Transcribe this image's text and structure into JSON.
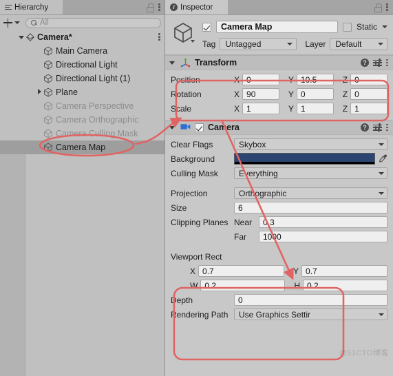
{
  "hierarchy": {
    "tab_label": "Hierarchy",
    "tab_icon": "hamburger-icon",
    "lock_icon": "lock-icon",
    "menu_icon": "kebab-menu-icon",
    "toolbar": {
      "add_icon": "plus-icon",
      "add_caret_icon": "chevron-down-icon",
      "search_icon": "search-icon",
      "search_placeholder": "All",
      "search_value": ""
    },
    "items": [
      {
        "label": "Camera*",
        "type": "scene",
        "indent": 0,
        "foldout": "open",
        "icon": "scene-icon",
        "dim": false,
        "selected": false,
        "menu_icon": "kebab-menu-icon"
      },
      {
        "label": "Main Camera",
        "type": "gameobject",
        "indent": 1,
        "foldout": "none",
        "icon": "gameobject-icon",
        "dim": false,
        "selected": false
      },
      {
        "label": "Directional Light",
        "type": "gameobject",
        "indent": 1,
        "foldout": "none",
        "icon": "gameobject-icon",
        "dim": false,
        "selected": false
      },
      {
        "label": "Directional Light (1)",
        "type": "gameobject",
        "indent": 1,
        "foldout": "none",
        "icon": "gameobject-icon",
        "dim": false,
        "selected": false
      },
      {
        "label": "Plane",
        "type": "gameobject",
        "indent": 1,
        "foldout": "closed",
        "icon": "gameobject-icon",
        "dim": false,
        "selected": false
      },
      {
        "label": "Camera Perspective",
        "type": "gameobject",
        "indent": 1,
        "foldout": "none",
        "icon": "gameobject-icon",
        "dim": true,
        "selected": false
      },
      {
        "label": "Camera Orthographic",
        "type": "gameobject",
        "indent": 1,
        "foldout": "none",
        "icon": "gameobject-icon",
        "dim": true,
        "selected": false
      },
      {
        "label": "Camera Culling Mask",
        "type": "gameobject",
        "indent": 1,
        "foldout": "none",
        "icon": "gameobject-icon",
        "dim": true,
        "selected": false
      },
      {
        "label": "Camera Map",
        "type": "gameobject",
        "indent": 1,
        "foldout": "none",
        "icon": "gameobject-icon",
        "dim": false,
        "selected": true
      }
    ]
  },
  "inspector": {
    "tab_label": "Inspector",
    "tab_icon": "info-icon",
    "lock_icon": "lock-icon",
    "menu_icon": "kebab-menu-icon",
    "header": {
      "object_icon": "gameobject-icon",
      "enabled": true,
      "name_value": "Camera Map",
      "static_checked": false,
      "static_label": "Static",
      "static_caret_icon": "chevron-down-icon",
      "tag_label": "Tag",
      "tag_value": "Untagged",
      "layer_label": "Layer",
      "layer_value": "Default"
    },
    "components": [
      {
        "title": "Transform",
        "icon": "transform-gizmo-icon",
        "foldout": "open",
        "help_icon": "help-icon",
        "preset_icon": "preset-settings-icon",
        "menu_icon": "kebab-menu-icon",
        "rows": [
          {
            "kind": "vector3",
            "name": "Position",
            "axes": [
              "X",
              "Y",
              "Z"
            ],
            "values": [
              "0",
              "10.5",
              "0"
            ]
          },
          {
            "kind": "vector3",
            "name": "Rotation",
            "axes": [
              "X",
              "Y",
              "Z"
            ],
            "values": [
              "90",
              "0",
              "0"
            ]
          },
          {
            "kind": "vector3",
            "name": "Scale",
            "axes": [
              "X",
              "Y",
              "Z"
            ],
            "values": [
              "1",
              "1",
              "1"
            ]
          }
        ]
      },
      {
        "title": "Camera",
        "icon": "camera-component-icon",
        "foldout": "open",
        "enabled": true,
        "help_icon": "help-icon",
        "preset_icon": "preset-settings-icon",
        "menu_icon": "kebab-menu-icon",
        "rows": [
          {
            "kind": "dropdown",
            "name": "Clear Flags",
            "value": "Skybox"
          },
          {
            "kind": "color",
            "name": "Background",
            "color": "#2b4570",
            "alpha_color": "#000000",
            "picker_icon": "eyedropper-icon"
          },
          {
            "kind": "dropdown",
            "name": "Culling Mask",
            "value": "Everything"
          },
          {
            "kind": "spacer"
          },
          {
            "kind": "dropdown",
            "name": "Projection",
            "value": "Orthographic"
          },
          {
            "kind": "text",
            "name": "Size",
            "value": "6"
          },
          {
            "kind": "labeled",
            "name": "Clipping Planes",
            "sub_label": "Near",
            "value": "0.3"
          },
          {
            "kind": "labeled",
            "name": "",
            "sub_label": "Far",
            "value": "1000"
          },
          {
            "kind": "spacer"
          },
          {
            "kind": "header",
            "name": "Viewport Rect"
          },
          {
            "kind": "pair",
            "name": "",
            "axes": [
              "X",
              "Y"
            ],
            "values": [
              "0.7",
              "0.7"
            ]
          },
          {
            "kind": "pair",
            "name": "",
            "axes": [
              "W",
              "H"
            ],
            "values": [
              "0.2",
              "0.2"
            ]
          },
          {
            "kind": "text",
            "name": "Depth",
            "value": "0"
          },
          {
            "kind": "dropdown",
            "name": "Rendering Path",
            "value": "Use Graphics Settir"
          }
        ]
      }
    ]
  },
  "annotations": {
    "color": "#e06464",
    "shapes": [
      {
        "type": "ellipse",
        "name": "highlight-camera-map-row"
      },
      {
        "type": "rounded-rect",
        "name": "highlight-transform-position-rotation"
      },
      {
        "type": "rounded-rect",
        "name": "highlight-viewport-rect-depth"
      },
      {
        "type": "arrow",
        "name": "arrow-camera-map-to-transform"
      },
      {
        "type": "arrow",
        "name": "arrow-transform-to-viewport-rect"
      }
    ]
  },
  "watermark": {
    "text": "@51CTO博客"
  }
}
